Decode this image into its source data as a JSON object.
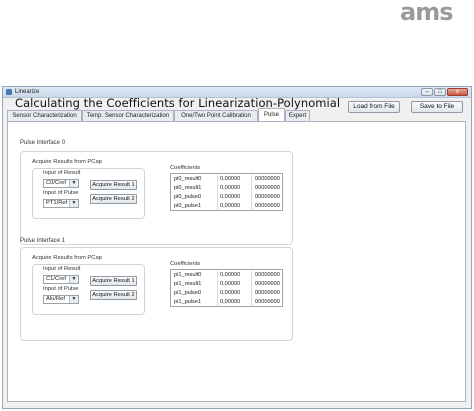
{
  "logo": {
    "text": "ams"
  },
  "window": {
    "title": "Linearize",
    "controls": {
      "minimize": "–",
      "maximize": "□",
      "close": "x"
    }
  },
  "main_title": "Calculating the Coefficients for Linearization-Polynomial",
  "buttons": {
    "load": "Load from File",
    "save": "Save to File"
  },
  "tabs": [
    {
      "label": "Sensor Characterization"
    },
    {
      "label": "Temp. Sensor Characterization"
    },
    {
      "label": "One/Two Point Calibration"
    },
    {
      "label": "Pulse",
      "active": true
    },
    {
      "label": "Expert"
    }
  ],
  "interfaces": [
    {
      "title": "Pulse Interface 0",
      "acquire_group": "Acquire Results from PCap",
      "input_result_label": "Input of Result",
      "input_result_value": "C0/Cref",
      "input_pulse_label": "Input of Pulse",
      "input_pulse_value": "PT1/Ref",
      "acquire_btn_1": "Acquire Result 1",
      "acquire_btn_2": "Acquire Result 2",
      "coef_label": "Coefficients",
      "coefficients": [
        {
          "name": "pi0_result0",
          "value": "0,00000",
          "hex": "00000000"
        },
        {
          "name": "pi0_result1",
          "value": "0,00000",
          "hex": "00000000"
        },
        {
          "name": "pi0_pulse0",
          "value": "0,00000",
          "hex": "00000000"
        },
        {
          "name": "pi0_pulse1",
          "value": "0,00000",
          "hex": "00000000"
        }
      ]
    },
    {
      "title": "Pulse Interface 1",
      "acquire_group": "Acquire Results from PCap",
      "input_result_label": "Input of Result",
      "input_result_value": "C1/Cref",
      "input_pulse_label": "Input of Pulse",
      "input_pulse_value": "Alu/Ref",
      "acquire_btn_1": "Acquire Result 1",
      "acquire_btn_2": "Acquire Result 2",
      "coef_label": "Coefficients",
      "coefficients": [
        {
          "name": "pi1_result0",
          "value": "0,00000",
          "hex": "00000000"
        },
        {
          "name": "pi1_result1",
          "value": "0,00000",
          "hex": "00000000"
        },
        {
          "name": "pi1_pulse0",
          "value": "0,00000",
          "hex": "00000000"
        },
        {
          "name": "pi1_pulse1",
          "value": "0,00000",
          "hex": "00000000"
        }
      ]
    }
  ],
  "colors": {
    "accent": "#4a79b5",
    "logo": "#9a9a9a"
  }
}
